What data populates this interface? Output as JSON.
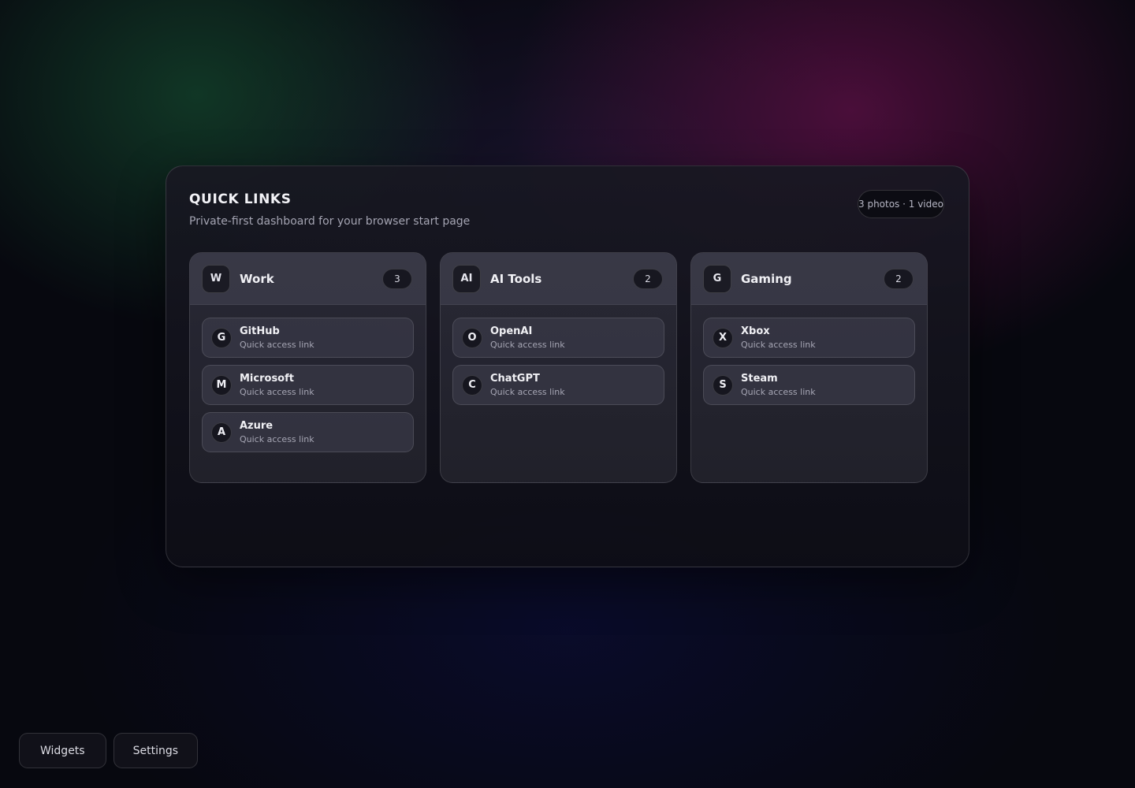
{
  "panel": {
    "title": "QUICK LINKS",
    "subtitle": "Private-first dashboard for your browser start page",
    "media_badge": "3 photos · 1 video"
  },
  "groups": [
    {
      "avatar": "W",
      "name": "Work",
      "count": "3",
      "links": [
        {
          "avatar": "G",
          "name": "GitHub",
          "subtitle": "Quick access link"
        },
        {
          "avatar": "M",
          "name": "Microsoft",
          "subtitle": "Quick access link"
        },
        {
          "avatar": "A",
          "name": "Azure",
          "subtitle": "Quick access link"
        }
      ]
    },
    {
      "avatar": "AI",
      "name": "AI Tools",
      "count": "2",
      "links": [
        {
          "avatar": "O",
          "name": "OpenAI",
          "subtitle": "Quick access link"
        },
        {
          "avatar": "C",
          "name": "ChatGPT",
          "subtitle": "Quick access link"
        }
      ]
    },
    {
      "avatar": "G",
      "name": "Gaming",
      "count": "2",
      "links": [
        {
          "avatar": "X",
          "name": "Xbox",
          "subtitle": "Quick access link"
        },
        {
          "avatar": "S",
          "name": "Steam",
          "subtitle": "Quick access link"
        }
      ]
    }
  ],
  "bottom_bar": {
    "widgets_label": "Widgets",
    "settings_label": "Settings"
  }
}
